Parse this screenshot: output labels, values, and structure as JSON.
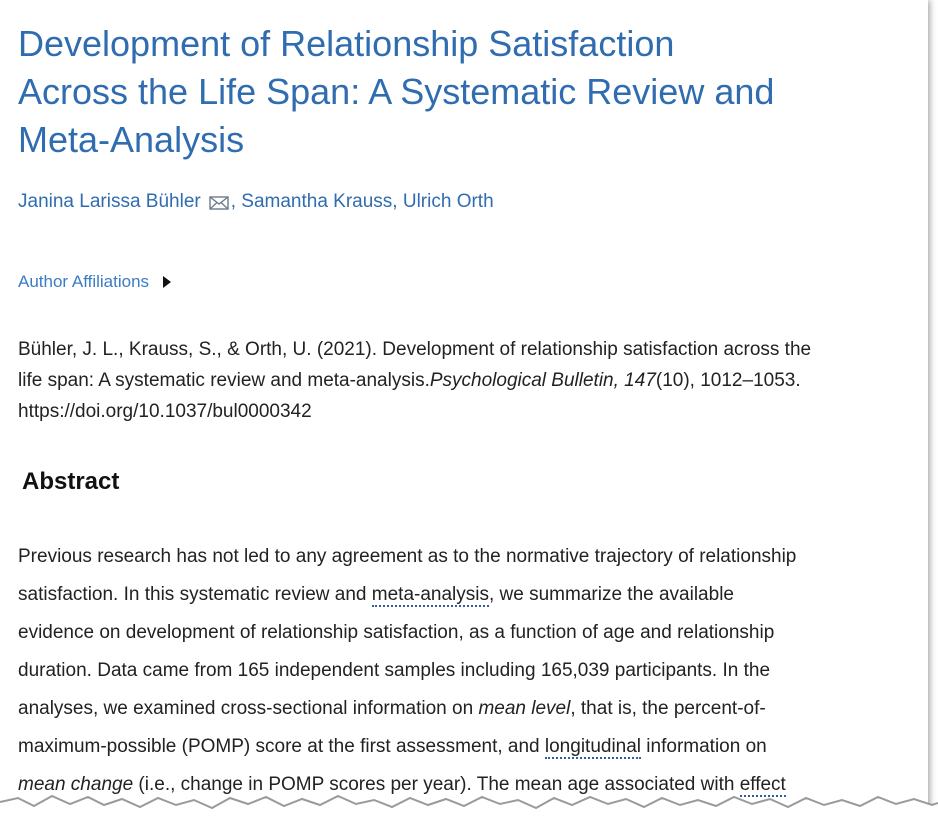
{
  "article": {
    "title_lines": [
      "Development of Relationship Satisfaction",
      "Across the Life Span: A Systematic Review and",
      "Meta-Analysis"
    ],
    "authors": {
      "first": "Janina Larissa Bühler",
      "rest": ", Samantha Krauss, Ulrich Orth",
      "mail_icon": "envelope-icon"
    },
    "affiliations_label": "Author Affiliations",
    "citation": {
      "line1": "Bühler, J. L., Krauss, S., & Orth, U. (2021). Development of relationship satisfaction across the",
      "line2_plain": "life span: A systematic review and meta-analysis.",
      "journal": "Psychological Bulletin, 147",
      "issue": "(10), 1012–1053.",
      "doi": "https://doi.org/10.1037/bul0000342"
    },
    "abstract": {
      "heading": "Abstract",
      "l1": "Previous research has not led to any agreement as to the normative trajectory of relationship",
      "l2_a": "satisfaction. In this systematic review and ",
      "l2_term": "meta-analysis",
      "l2_b": ", we summarize the available",
      "l3": "evidence on development of relationship satisfaction, as a function of age and relationship",
      "l4": "duration. Data came from 165 independent samples including 165,039 participants. In the",
      "l5_a": "analyses, we examined cross-sectional information on ",
      "l5_em": "mean level",
      "l5_b": ", that is, the percent-of-",
      "l6_a": "maximum-possible (POMP) score at the first assessment, and ",
      "l6_term": "longitudinal",
      "l6_b": " information on",
      "l7_em": "mean change",
      "l7_a": " (i.e., change in POMP scores per year). The mean age associated with ",
      "l7_term": "effect"
    }
  },
  "colors": {
    "link": "#2f6cb0",
    "text": "#222222",
    "term_underline": "#2f5ea8"
  }
}
